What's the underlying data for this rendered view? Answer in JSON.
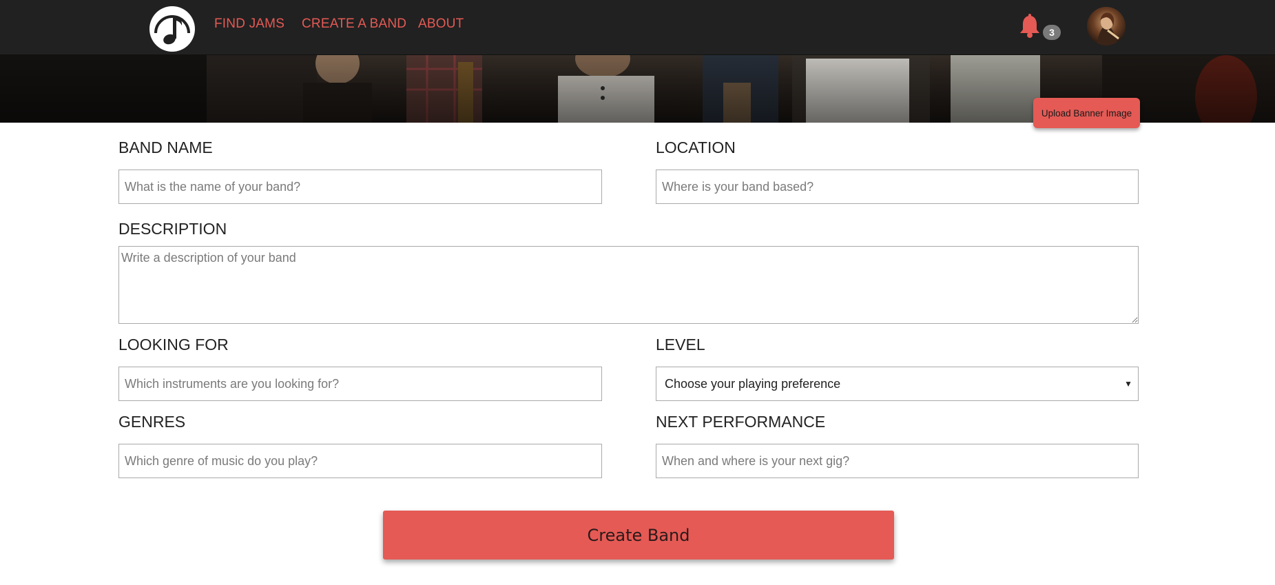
{
  "nav": {
    "links": [
      "FIND JAMS",
      "CREATE A BAND",
      "ABOUT"
    ],
    "notification_count": "3"
  },
  "banner": {
    "upload_label": "Upload Banner Image"
  },
  "form": {
    "band_name": {
      "label": "BAND NAME",
      "placeholder": "What is the name of your band?",
      "value": ""
    },
    "location": {
      "label": "LOCATION",
      "placeholder": "Where is your band based?",
      "value": ""
    },
    "description": {
      "label": "DESCRIPTION",
      "placeholder": "Write a description of your band",
      "value": ""
    },
    "looking_for": {
      "label": "LOOKING FOR",
      "placeholder": "Which instruments are you looking for?",
      "value": ""
    },
    "level": {
      "label": "LEVEL",
      "selected": "Choose your playing preference"
    },
    "genres": {
      "label": "GENRES",
      "placeholder": "Which genre of music do you play?",
      "value": ""
    },
    "next_performance": {
      "label": "NEXT PERFORMANCE",
      "placeholder": "When and where is your next gig?",
      "value": ""
    },
    "submit_label": "Create Band"
  },
  "icons": {
    "logo": "music-note-logo",
    "notifications": "bell-icon",
    "select_caret": "caret-down-icon"
  },
  "colors": {
    "accent": "#e55a55",
    "navbar": "#212121",
    "badge": "#7a7a7a"
  }
}
